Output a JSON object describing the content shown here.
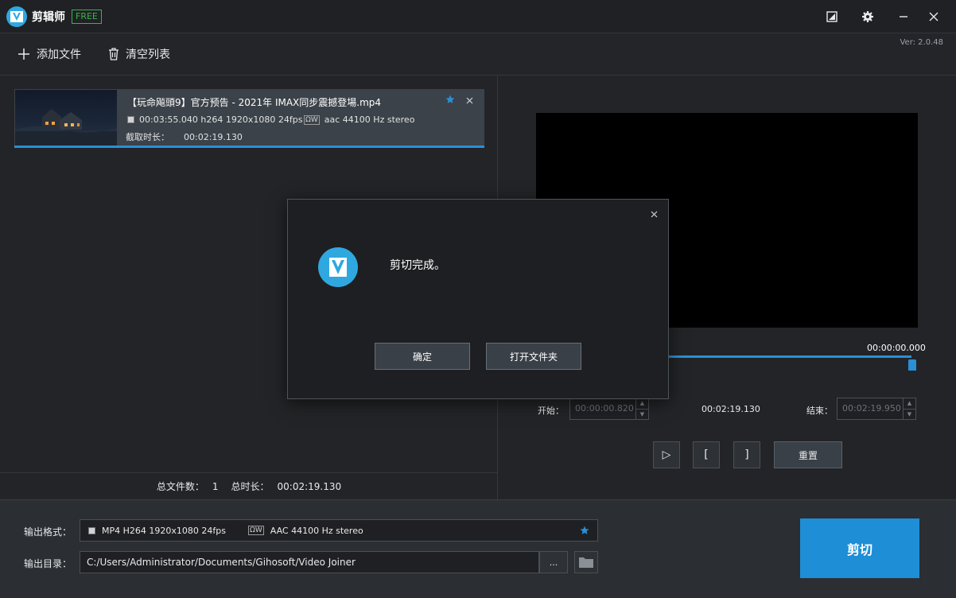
{
  "titlebar": {
    "app_title": "剪辑师",
    "free_badge": "FREE",
    "version": "Ver: 2.0.48"
  },
  "toolbar": {
    "add_file": "添加文件",
    "clear_list": "清空列表"
  },
  "file_item": {
    "name": "【玩命飚頭9】官方预告 - 2021年 IMAX同步震撼登場.mp4",
    "video_info": "00:03:55.040 h264 1920x1080 24fps",
    "audio_info": "aac 44100 Hz stereo",
    "audio_tag": "ΩW",
    "clip_label": "截取时长：",
    "clip_value": "00:02:19.130"
  },
  "left_footer": {
    "count_label": "总文件数：",
    "count_value": "1",
    "duration_label": "总时长：",
    "duration_value": "00:02:19.130"
  },
  "preview": {
    "time_readout": "00:00:00.000"
  },
  "trim": {
    "start_label": "开始：",
    "start_value": "00:00:00.820",
    "duration_value": "00:02:19.130",
    "end_label": "结束：",
    "end_value": "00:02:19.950",
    "play_glyph": "▷",
    "mark_in_glyph": "[",
    "mark_out_glyph": "]",
    "reset_label": "重置"
  },
  "output": {
    "format_label": "输出格式：",
    "format_video": "MP4 H264 1920x1080 24fps",
    "format_audio": "AAC 44100 Hz stereo",
    "audio_tag": "ΩW",
    "dir_label": "输出目录：",
    "dir_value": "C:/Users/Administrator/Documents/Gihosoft/Video Joiner",
    "browse_label": "...",
    "cut_label": "剪切"
  },
  "dialog": {
    "message": "剪切完成。",
    "ok_label": "确定",
    "open_folder_label": "打开文件夹"
  },
  "colors": {
    "accent": "#1e8ed6",
    "free_green": "#39b54a",
    "logo_blue": "#2fa8e0"
  }
}
